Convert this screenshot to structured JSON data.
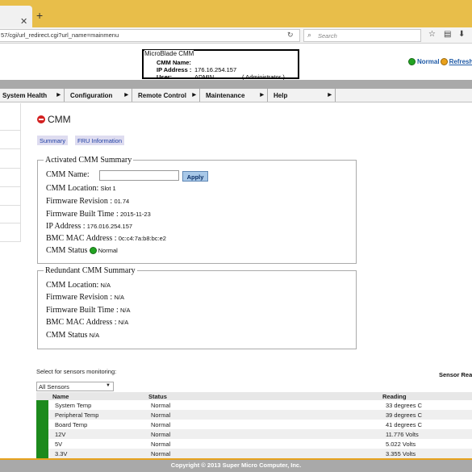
{
  "browser": {
    "url": "57/cgi/url_redirect.cgi?url_name=mainmenu",
    "search_placeholder": "Search"
  },
  "header": {
    "box_title": "MicroBlade CMM",
    "cmm_name_label": "CMM Name:",
    "ip_label": "IP Address :",
    "ip_value": "176.16.254.157",
    "user_label": "User:",
    "user_value": "ADMIN",
    "user_role": "( Administrator )",
    "status_text": "Normal",
    "refresh_text": "Refresh"
  },
  "nav": {
    "items": [
      {
        "label": "System Health"
      },
      {
        "label": "Configuration"
      },
      {
        "label": "Remote Control"
      },
      {
        "label": "Maintenance"
      },
      {
        "label": "Help"
      }
    ]
  },
  "page": {
    "title": "CMM",
    "tabs": [
      {
        "label": "Summary"
      },
      {
        "label": "FRU Information"
      }
    ]
  },
  "activated": {
    "legend": "Activated CMM Summary",
    "cmm_name_label": "CMM Name:",
    "apply_label": "Apply",
    "location_label": "CMM Location:",
    "location_value": "Slot 1",
    "fw_rev_label": "Firmware Revision :",
    "fw_rev_value": "01.74",
    "fw_built_label": "Firmware Built Time :",
    "fw_built_value": "2015-11-23",
    "ip_label": "IP Address :",
    "ip_value": "176.016.254.157",
    "mac_label": "BMC MAC Address :",
    "mac_value": "0c:c4:7a:b8:bc:e2",
    "status_label": "CMM Status",
    "status_value": "Normal"
  },
  "redundant": {
    "legend": "Redundant CMM Summary",
    "location_label": "CMM Location:",
    "location_value": "N/A",
    "fw_rev_label": "Firmware Revision :",
    "fw_rev_value": "N/A",
    "fw_built_label": "Firmware Built Time :",
    "fw_built_value": "N/A",
    "mac_label": "BMC MAC Address :",
    "mac_value": "N/A",
    "status_label": "CMM Status",
    "status_value": "N/A"
  },
  "sensors": {
    "select_label": "Select for sensors monitoring:",
    "select_value": "All Sensors",
    "readings_title": "Sensor Rea",
    "columns": {
      "name": "Name",
      "status": "Status",
      "reading": "Reading"
    },
    "rows": [
      {
        "name": "System Temp",
        "status": "Normal",
        "reading": "33 degrees C"
      },
      {
        "name": "Peripheral Temp",
        "status": "Normal",
        "reading": "39 degrees C"
      },
      {
        "name": "Board Temp",
        "status": "Normal",
        "reading": "41 degrees C"
      },
      {
        "name": "12V",
        "status": "Normal",
        "reading": "11.776 Volts"
      },
      {
        "name": "5V",
        "status": "Normal",
        "reading": "5.022 Volts"
      },
      {
        "name": "3.3V",
        "status": "Normal",
        "reading": "3.355 Volts"
      }
    ]
  },
  "footer": {
    "copyright": "Copyright © 2013 Super Micro Computer, Inc."
  },
  "colors": {
    "tabbar": "#e8be4a",
    "status_green": "#22a422",
    "footer_border": "#e6a21e",
    "link_blue": "#1e3ea4"
  }
}
